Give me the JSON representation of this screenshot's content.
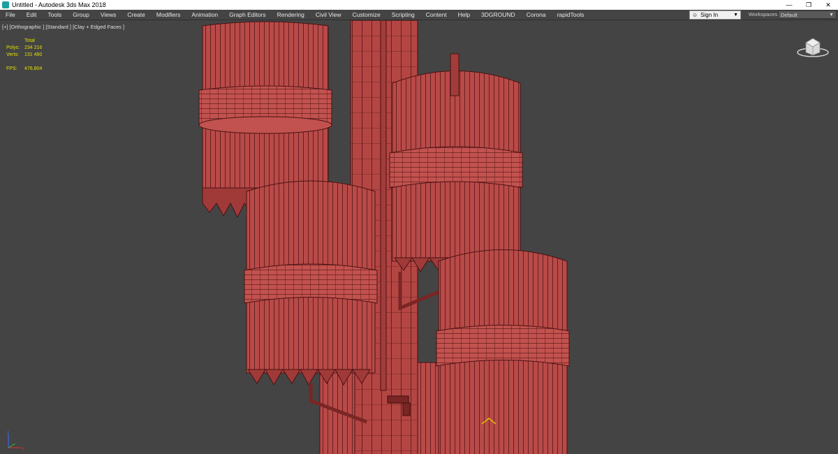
{
  "window": {
    "title": "Untitled - Autodesk 3ds Max 2018",
    "controls": [
      "—",
      "❐",
      "✕"
    ]
  },
  "menu": {
    "items": [
      "File",
      "Edit",
      "Tools",
      "Group",
      "Views",
      "Create",
      "Modifiers",
      "Animation",
      "Graph Editors",
      "Rendering",
      "Civil View",
      "Customize",
      "Scripting",
      "Content",
      "Help",
      "3DGROUND",
      "Corona",
      "rapidTools"
    ]
  },
  "account": {
    "signin_label": "Sign In",
    "workspaces_label": "Workspaces:",
    "workspace_value": "Default"
  },
  "viewport": {
    "label": "[+] [Orthographic ] [Standard ] [Clay + Edged Faces ]",
    "stats": {
      "total_label": "Total",
      "polys_label": "Polys:",
      "polys_value": "234 216",
      "verts_label": "Verts:",
      "verts_value": "131 460",
      "fps_label": "FPS:",
      "fps_value": "476,804"
    }
  },
  "colors": {
    "viewport_bg": "#444444",
    "mesh_fill": "#b84a48",
    "mesh_wire": "#5a1818",
    "stats_text": "#e3e000"
  }
}
